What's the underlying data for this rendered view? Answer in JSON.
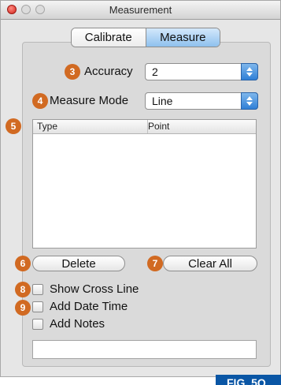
{
  "window": {
    "title": "Measurement"
  },
  "tabs": {
    "calibrate": "Calibrate",
    "measure": "Measure"
  },
  "accuracy": {
    "label": "Accuracy",
    "value": "2",
    "badge": "3"
  },
  "mode": {
    "label": "Measure Mode",
    "value": "Line",
    "badge": "4"
  },
  "table": {
    "badge": "5",
    "columns": [
      "Type",
      "Point"
    ],
    "rows": []
  },
  "buttons": {
    "delete": "Delete",
    "delete_badge": "6",
    "clear_all": "Clear All",
    "clear_badge": "7"
  },
  "options": [
    {
      "label": "Show Cross Line",
      "badge": "8",
      "checked": false
    },
    {
      "label": "Add Date Time",
      "badge": "9",
      "checked": false
    },
    {
      "label": "Add Notes",
      "badge": "",
      "checked": false
    }
  ],
  "notes": {
    "value": ""
  },
  "figure_label": "FIG. 5Q",
  "colors": {
    "badge": "#d16a22",
    "selected_tab": "#8ec1ee",
    "popup_arrow": "#2f7fd6",
    "figure_tag": "#0a56a5"
  }
}
